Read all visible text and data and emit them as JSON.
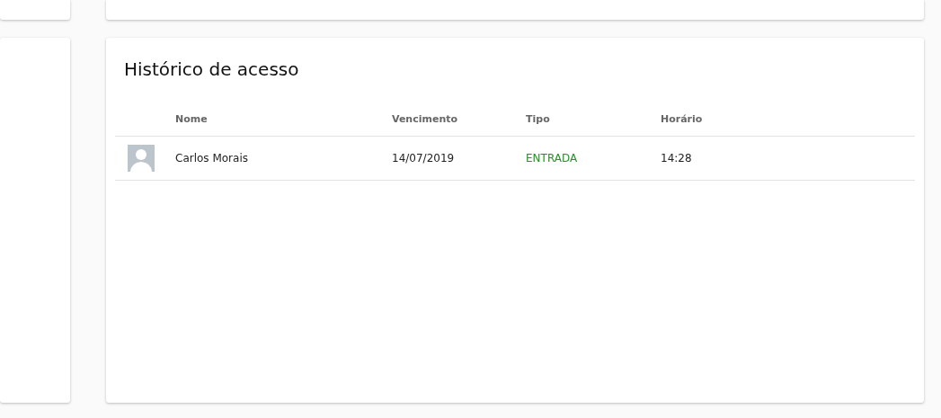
{
  "access_history": {
    "title": "Histórico de acesso",
    "columns": [
      "Nome",
      "Vencimento",
      "Tipo",
      "Horário"
    ],
    "rows": [
      {
        "name": "Carlos Morais",
        "due_date": "14/07/2019",
        "type": "ENTRADA",
        "color": "#1a9a1a",
        "time": "14:28"
      }
    ]
  }
}
